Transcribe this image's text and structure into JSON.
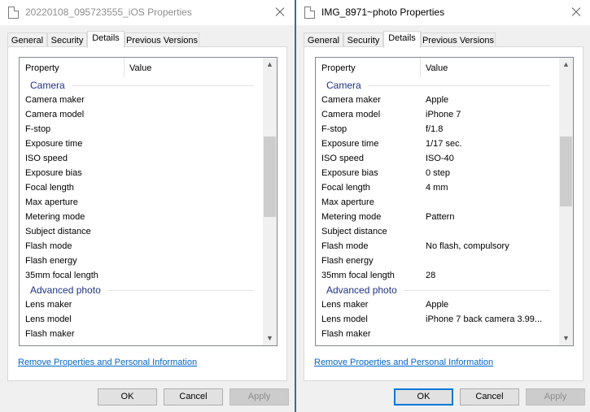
{
  "windows": [
    {
      "title": "20220108_095723555_iOS Properties",
      "tabs": [
        "General",
        "Security",
        "Details",
        "Previous Versions"
      ],
      "active_tab": "Details",
      "columns": {
        "property": "Property",
        "value": "Value"
      },
      "rows": [
        {
          "type": "group",
          "label": "Camera"
        },
        {
          "type": "item",
          "property": "Camera maker",
          "value": ""
        },
        {
          "type": "item",
          "property": "Camera model",
          "value": ""
        },
        {
          "type": "item",
          "property": "F-stop",
          "value": ""
        },
        {
          "type": "item",
          "property": "Exposure time",
          "value": ""
        },
        {
          "type": "item",
          "property": "ISO speed",
          "value": ""
        },
        {
          "type": "item",
          "property": "Exposure bias",
          "value": ""
        },
        {
          "type": "item",
          "property": "Focal length",
          "value": ""
        },
        {
          "type": "item",
          "property": "Max aperture",
          "value": ""
        },
        {
          "type": "item",
          "property": "Metering mode",
          "value": ""
        },
        {
          "type": "item",
          "property": "Subject distance",
          "value": ""
        },
        {
          "type": "item",
          "property": "Flash mode",
          "value": ""
        },
        {
          "type": "item",
          "property": "Flash energy",
          "value": ""
        },
        {
          "type": "item",
          "property": "35mm focal length",
          "value": ""
        },
        {
          "type": "group",
          "label": "Advanced photo"
        },
        {
          "type": "item",
          "property": "Lens maker",
          "value": ""
        },
        {
          "type": "item",
          "property": "Lens model",
          "value": ""
        },
        {
          "type": "item",
          "property": "Flash maker",
          "value": ""
        }
      ],
      "scroll": {
        "position": 0.36,
        "visible_fraction": 0.31
      },
      "remove_link": "Remove Properties and Personal Information",
      "buttons": {
        "ok": "OK",
        "cancel": "Cancel",
        "apply": "Apply"
      },
      "default_button": "none"
    },
    {
      "title": "IMG_8971~photo Properties",
      "tabs": [
        "General",
        "Security",
        "Details",
        "Previous Versions"
      ],
      "active_tab": "Details",
      "columns": {
        "property": "Property",
        "value": "Value"
      },
      "rows": [
        {
          "type": "group",
          "label": "Camera"
        },
        {
          "type": "item",
          "property": "Camera maker",
          "value": "Apple"
        },
        {
          "type": "item",
          "property": "Camera model",
          "value": "iPhone 7"
        },
        {
          "type": "item",
          "property": "F-stop",
          "value": "f/1.8"
        },
        {
          "type": "item",
          "property": "Exposure time",
          "value": "1/17 sec."
        },
        {
          "type": "item",
          "property": "ISO speed",
          "value": "ISO-40"
        },
        {
          "type": "item",
          "property": "Exposure bias",
          "value": "0 step"
        },
        {
          "type": "item",
          "property": "Focal length",
          "value": "4 mm"
        },
        {
          "type": "item",
          "property": "Max aperture",
          "value": ""
        },
        {
          "type": "item",
          "property": "Metering mode",
          "value": "Pattern"
        },
        {
          "type": "item",
          "property": "Subject distance",
          "value": ""
        },
        {
          "type": "item",
          "property": "Flash mode",
          "value": "No flash, compulsory"
        },
        {
          "type": "item",
          "property": "Flash energy",
          "value": ""
        },
        {
          "type": "item",
          "property": "35mm focal length",
          "value": "28"
        },
        {
          "type": "group",
          "label": "Advanced photo"
        },
        {
          "type": "item",
          "property": "Lens maker",
          "value": "Apple"
        },
        {
          "type": "item",
          "property": "Lens model",
          "value": "iPhone 7 back camera 3.99..."
        },
        {
          "type": "item",
          "property": "Flash maker",
          "value": ""
        }
      ],
      "scroll": {
        "position": 0.34,
        "visible_fraction": 0.27
      },
      "remove_link": "Remove Properties and Personal Information",
      "buttons": {
        "ok": "OK",
        "cancel": "Cancel",
        "apply": "Apply"
      },
      "default_button": "ok"
    }
  ],
  "colors": {
    "accent": "#0078d7",
    "link": "#0066cc",
    "group_header": "#1e3287",
    "window_bg": "#f0f0f0",
    "divider": "#3a6b95"
  },
  "icons": {
    "title": "file-icon",
    "close": "close-icon",
    "scroll_up": "chevron-up-icon",
    "scroll_down": "chevron-down-icon"
  }
}
